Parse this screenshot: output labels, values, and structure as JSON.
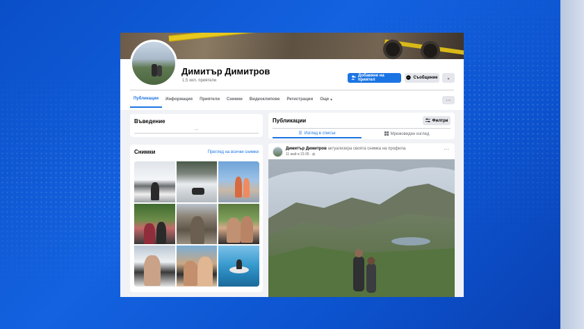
{
  "profile": {
    "name": "Димитър Димитров",
    "friends": "1,5 хил. приятели",
    "add_friend_label": "Добавяне на приятел",
    "message_label": "Съобщение",
    "more_label": "⌄"
  },
  "tabs": [
    {
      "label": "Публикации"
    },
    {
      "label": "Информация"
    },
    {
      "label": "Приятели"
    },
    {
      "label": "Снимки"
    },
    {
      "label": "Видеоклипове"
    },
    {
      "label": "Регистрации"
    },
    {
      "label": "Още"
    }
  ],
  "tabs_more_label": "···",
  "intro": {
    "title": "Въведение",
    "dots": "..."
  },
  "photos": {
    "title": "Снимки",
    "see_all": "Преглед на всички снимки"
  },
  "publications": {
    "title": "Публикации",
    "filters_label": "Филтри",
    "list_view": "Изглед в списък",
    "grid_view": "Мрежовиден изглед"
  },
  "post": {
    "author": "Димитър Димитров",
    "action": "актуализира своята снимка на профила.",
    "date": "11 май в 23:35 ·",
    "more": "···"
  },
  "colors": {
    "accent": "#1b74e4",
    "page_bg": "#f0f2f5",
    "backdrop": "#1462e0"
  }
}
